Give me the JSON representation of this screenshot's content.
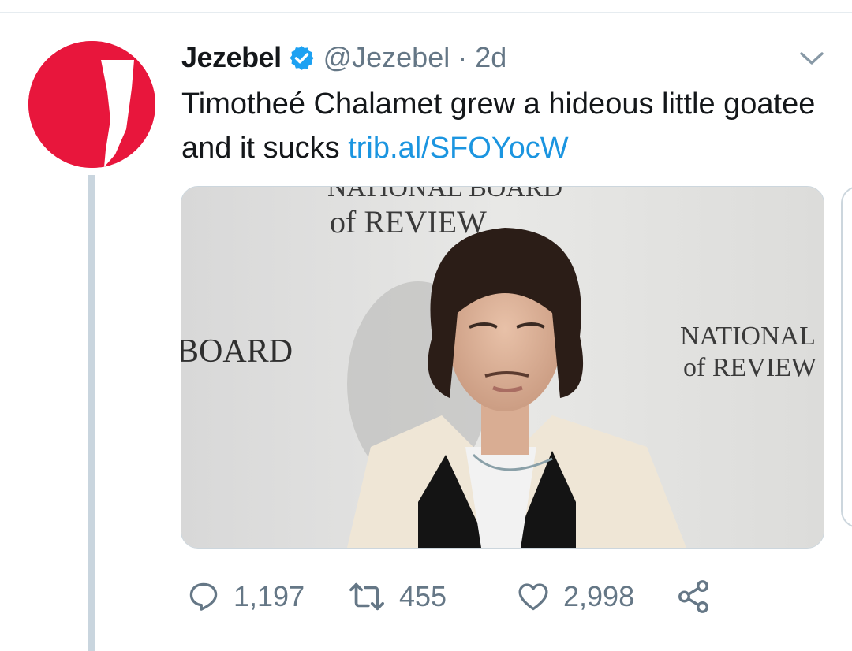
{
  "tweet": {
    "display_name": "Jezebel",
    "verified": true,
    "handle": "@Jezebel",
    "separator": "·",
    "time": "2d",
    "text": "Timotheé Chalamet grew a hideous little goatee and it sucks",
    "link": "trib.al/SFOYocW",
    "avatar_letter": "J",
    "image_signage": {
      "top_line_1": "NATIONAL BOARD",
      "top_line_2": "of REVIEW",
      "left": "BOARD",
      "right_line_1": "NATIONAL",
      "right_line_2": "of REVIEW"
    }
  },
  "actions": {
    "reply_count": "1,197",
    "retweet_count": "455",
    "like_count": "2,998"
  },
  "icons": {
    "reply": "reply-icon",
    "retweet": "retweet-icon",
    "like": "heart-icon",
    "share": "share-icon",
    "more": "chevron-down-icon",
    "verified": "verified-badge-icon"
  },
  "colors": {
    "brand_red": "#e8163c",
    "link_blue": "#1b95e0",
    "verified_blue": "#1da1f2",
    "muted_gray": "#657786"
  }
}
